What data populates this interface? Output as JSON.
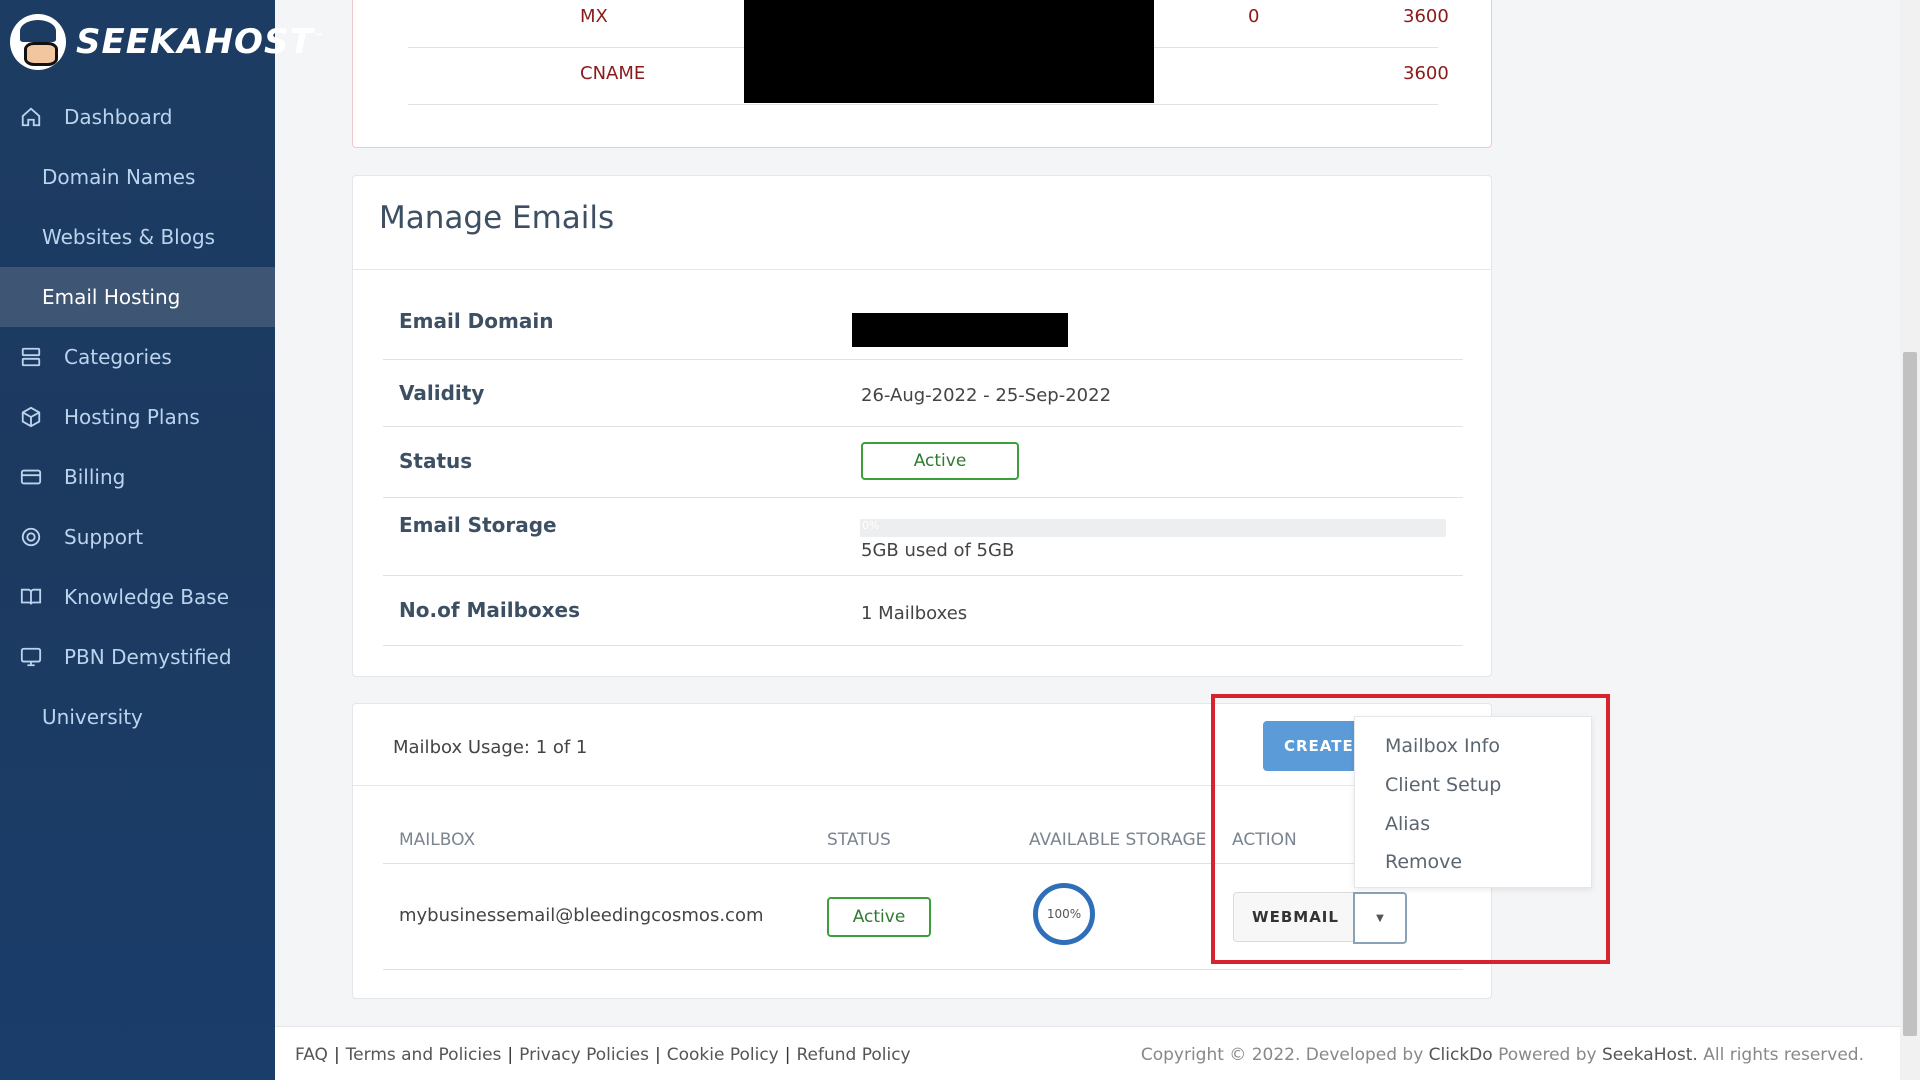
{
  "brand": {
    "name": "SEEKAHOST",
    "tm": "™"
  },
  "sidebar": {
    "items": [
      {
        "label": "Dashboard",
        "icon": "home-icon"
      },
      {
        "label": "Domain Names",
        "icon": ""
      },
      {
        "label": "Websites & Blogs",
        "icon": ""
      },
      {
        "label": "Email Hosting",
        "icon": "",
        "active": true
      },
      {
        "label": "Categories",
        "icon": "server-icon"
      },
      {
        "label": "Hosting Plans",
        "icon": "box-icon"
      },
      {
        "label": "Billing",
        "icon": "credit-card-icon"
      },
      {
        "label": "Support",
        "icon": "lifebuoy-icon"
      },
      {
        "label": "Knowledge Base",
        "icon": "book-icon"
      },
      {
        "label": "PBN Demystified",
        "icon": "monitor-icon"
      },
      {
        "label": "University",
        "icon": ""
      }
    ]
  },
  "dns": {
    "rows": [
      {
        "type": "MX",
        "priority": "0",
        "ttl": "3600"
      },
      {
        "type": "CNAME",
        "priority": "",
        "ttl": "3600"
      }
    ]
  },
  "manage": {
    "title": "Manage Emails",
    "rows": {
      "domain_label": "Email Domain",
      "validity_label": "Validity",
      "validity_value": "26-Aug-2022 - 25-Sep-2022",
      "status_label": "Status",
      "status_value": "Active",
      "storage_label": "Email Storage",
      "storage_bar_text": "0%",
      "storage_used_fraction": 0,
      "storage_value": "5GB used of 5GB",
      "mailboxes_label": "No.of Mailboxes",
      "mailboxes_value": "1 Mailboxes"
    }
  },
  "mailbox": {
    "usage": "Mailbox Usage: 1 of 1",
    "create_label": "CREATE",
    "columns": [
      "MAILBOX",
      "STATUS",
      "AVAILABLE STORAGE",
      "ACTION"
    ],
    "row": {
      "email": "mybusinessemail@bleedingcosmos.com",
      "status": "Active",
      "storage": "100%",
      "webmail_label": "WEBMAIL"
    },
    "dropdown": [
      "Mailbox Info",
      "Client Setup",
      "Alias",
      "Remove"
    ]
  },
  "footer": {
    "links": [
      "FAQ",
      "Terms and Policies",
      "Privacy Policies",
      "Cookie Policy",
      "Refund Policy"
    ],
    "copy_prefix": "Copyright © 2022. Developed by",
    "developer": "ClickDo",
    "powered_prefix": "Powered by",
    "powered": "SeekaHost.",
    "rights": "All rights reserved."
  },
  "colors": {
    "sidebar": "#1d3c63",
    "accent": "#5b9bd8",
    "active_green": "#3aa03a",
    "highlight_red": "#d6232e"
  }
}
